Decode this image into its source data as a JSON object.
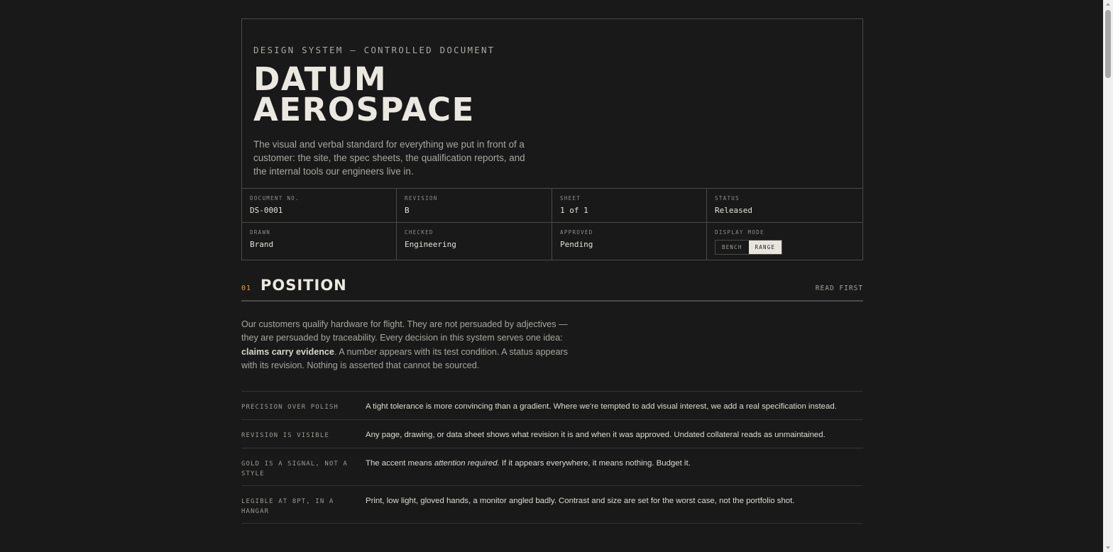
{
  "header": {
    "eyebrow": "DESIGN SYSTEM — CONTROLLED DOCUMENT",
    "brand_line1": "DATUM",
    "brand_line2": "AEROSPACE",
    "lede": "The visual and verbal standard for everything we put in front of a customer: the site, the spec sheets, the qualification reports, and the internal tools our engineers live in."
  },
  "title_block": {
    "row1": [
      {
        "label": "DOCUMENT NO.",
        "value": "DS-0001"
      },
      {
        "label": "REVISION",
        "value": "B"
      },
      {
        "label": "SHEET",
        "value": "1 of 1"
      },
      {
        "label": "STATUS",
        "value": "Released"
      }
    ],
    "row2": [
      {
        "label": "DRAWN",
        "value": "Brand"
      },
      {
        "label": "CHECKED",
        "value": "Engineering"
      },
      {
        "label": "APPROVED",
        "value": "Pending"
      }
    ],
    "display_mode": {
      "label": "DISPLAY MODE",
      "options": [
        "BENCH",
        "RANGE"
      ],
      "selected": "RANGE"
    }
  },
  "section": {
    "number": "01",
    "title": "POSITION",
    "aside": "READ FIRST",
    "intro_part1": "Our customers qualify hardware for flight. They are not persuaded by adjectives — they are persuaded by traceability. Every decision in this system serves one idea: ",
    "intro_strong": "claims carry evidence",
    "intro_part2": ". A number appears with its test condition. A status appears with its revision. Nothing is asserted that cannot be sourced."
  },
  "principles": [
    {
      "label": "PRECISION OVER POLISH",
      "text": "A tight tolerance is more convincing than a gradient. Where we're tempted to add visual interest, we add a real specification instead."
    },
    {
      "label": "REVISION IS VISIBLE",
      "text": "Any page, drawing, or data sheet shows what revision it is and when it was approved. Undated collateral reads as unmaintained."
    },
    {
      "label": "GOLD IS A SIGNAL, NOT A STYLE",
      "text_before": "The accent means ",
      "text_em": "attention required.",
      "text_after": " If it appears everywhere, it means nothing. Budget it."
    },
    {
      "label": "LEGIBLE AT 8PT, IN A HANGAR",
      "text": "Print, low light, gloved hands, a monitor angled badly. Contrast and size are set for the worst case, not the portfolio shot."
    }
  ],
  "colors": {
    "background": "#181918",
    "text": "#e6e4dd",
    "muted": "#a8a7a1",
    "rule": "#4a4b49",
    "accent_gold": "#d6a849"
  }
}
